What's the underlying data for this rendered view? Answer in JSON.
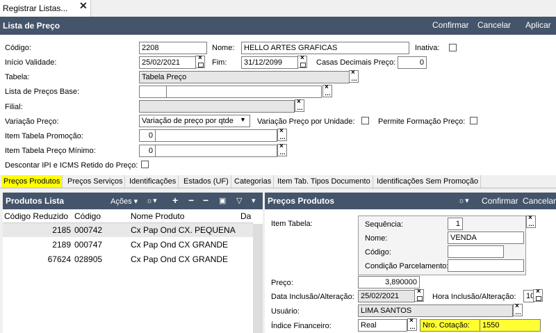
{
  "window_tab": {
    "title": "Registrar Listas...",
    "close": "✕"
  },
  "header": {
    "title": "Lista de Preço",
    "confirm": "Confirmar",
    "cancel": "Cancelar",
    "apply": "Aplicar"
  },
  "form": {
    "codigo": {
      "label": "Código:",
      "value": "2208"
    },
    "nome": {
      "label": "Nome:",
      "value": "HELLO ARTES GRAFICAS"
    },
    "inativa": {
      "label": "Inativa:"
    },
    "inicio": {
      "label": "Início Validade:",
      "value": "25/02/2021"
    },
    "fim": {
      "label": "Fim:",
      "value": "31/12/2099"
    },
    "casas": {
      "label": "Casas Decimais Preço:",
      "value": "0"
    },
    "tabela": {
      "label": "Tabela:",
      "value": "Tabela Preço"
    },
    "lista_base": {
      "label": "Lista de Preços Base:",
      "value": ""
    },
    "filial": {
      "label": "Filial:",
      "value": ""
    },
    "variacao": {
      "label": "Variação Preço:",
      "value": "Variação de preço por qtde"
    },
    "variacao_unidade": {
      "label": "Variação Preço por Unidade:"
    },
    "permite": {
      "label": "Permite Formação Preço:"
    },
    "promo": {
      "label": "Item Tabela Promoção:",
      "value": "0"
    },
    "minimo": {
      "label": "Item Tabela Preço Mínimo:",
      "value": "0"
    },
    "descontar": {
      "label": "Descontar IPI e ICMS Retido do Preço:"
    }
  },
  "subtabs": [
    "Preços Produtos",
    "Preços Serviços",
    "Identificações",
    "Estados (UF)",
    "Categorias",
    "Item Tab. Tipos Documento",
    "Identificações Sem Promoção"
  ],
  "left_panel": {
    "title": "Produtos Lista",
    "actions": "Ações",
    "columns": [
      "Código Reduzido",
      "Código",
      "Nome Produto",
      "Da"
    ],
    "rows": [
      {
        "reduzido": "2185",
        "codigo": "000742",
        "nome": "Cx Pap Ond CX. PEQUENA"
      },
      {
        "reduzido": "2189",
        "codigo": "000747",
        "nome": "Cx Pap Ond CX GRANDE"
      },
      {
        "reduzido": "67624",
        "codigo": "028905",
        "nome": "Cx Pap Ond CX GRANDE"
      }
    ]
  },
  "right_panel": {
    "title": "Preços Produtos",
    "confirm": "Confirmar",
    "cancel": "Cancelar",
    "item_tabela": "Item Tabela:",
    "sequencia": {
      "label": "Sequência:",
      "value": "1"
    },
    "nome": {
      "label": "Nome:",
      "value": "VENDA"
    },
    "codigo": {
      "label": "Código:",
      "value": ""
    },
    "condicao": {
      "label": "Condição Parcelamento:",
      "value": ""
    },
    "preco": {
      "label": "Preço:",
      "value": "3,890000"
    },
    "data": {
      "label": "Data Inclusão/Alteração:",
      "value": "25/02/2021"
    },
    "hora": {
      "label": "Hora Inclusão/Alteração:",
      "value": "10"
    },
    "usuario": {
      "label": "Usuário:",
      "value": "LIMA SANTOS"
    },
    "indice": {
      "label": "Índice Financeiro:",
      "value": "Real"
    },
    "cotacao": {
      "label": "Nro. Cotação:",
      "value": "1550"
    }
  }
}
